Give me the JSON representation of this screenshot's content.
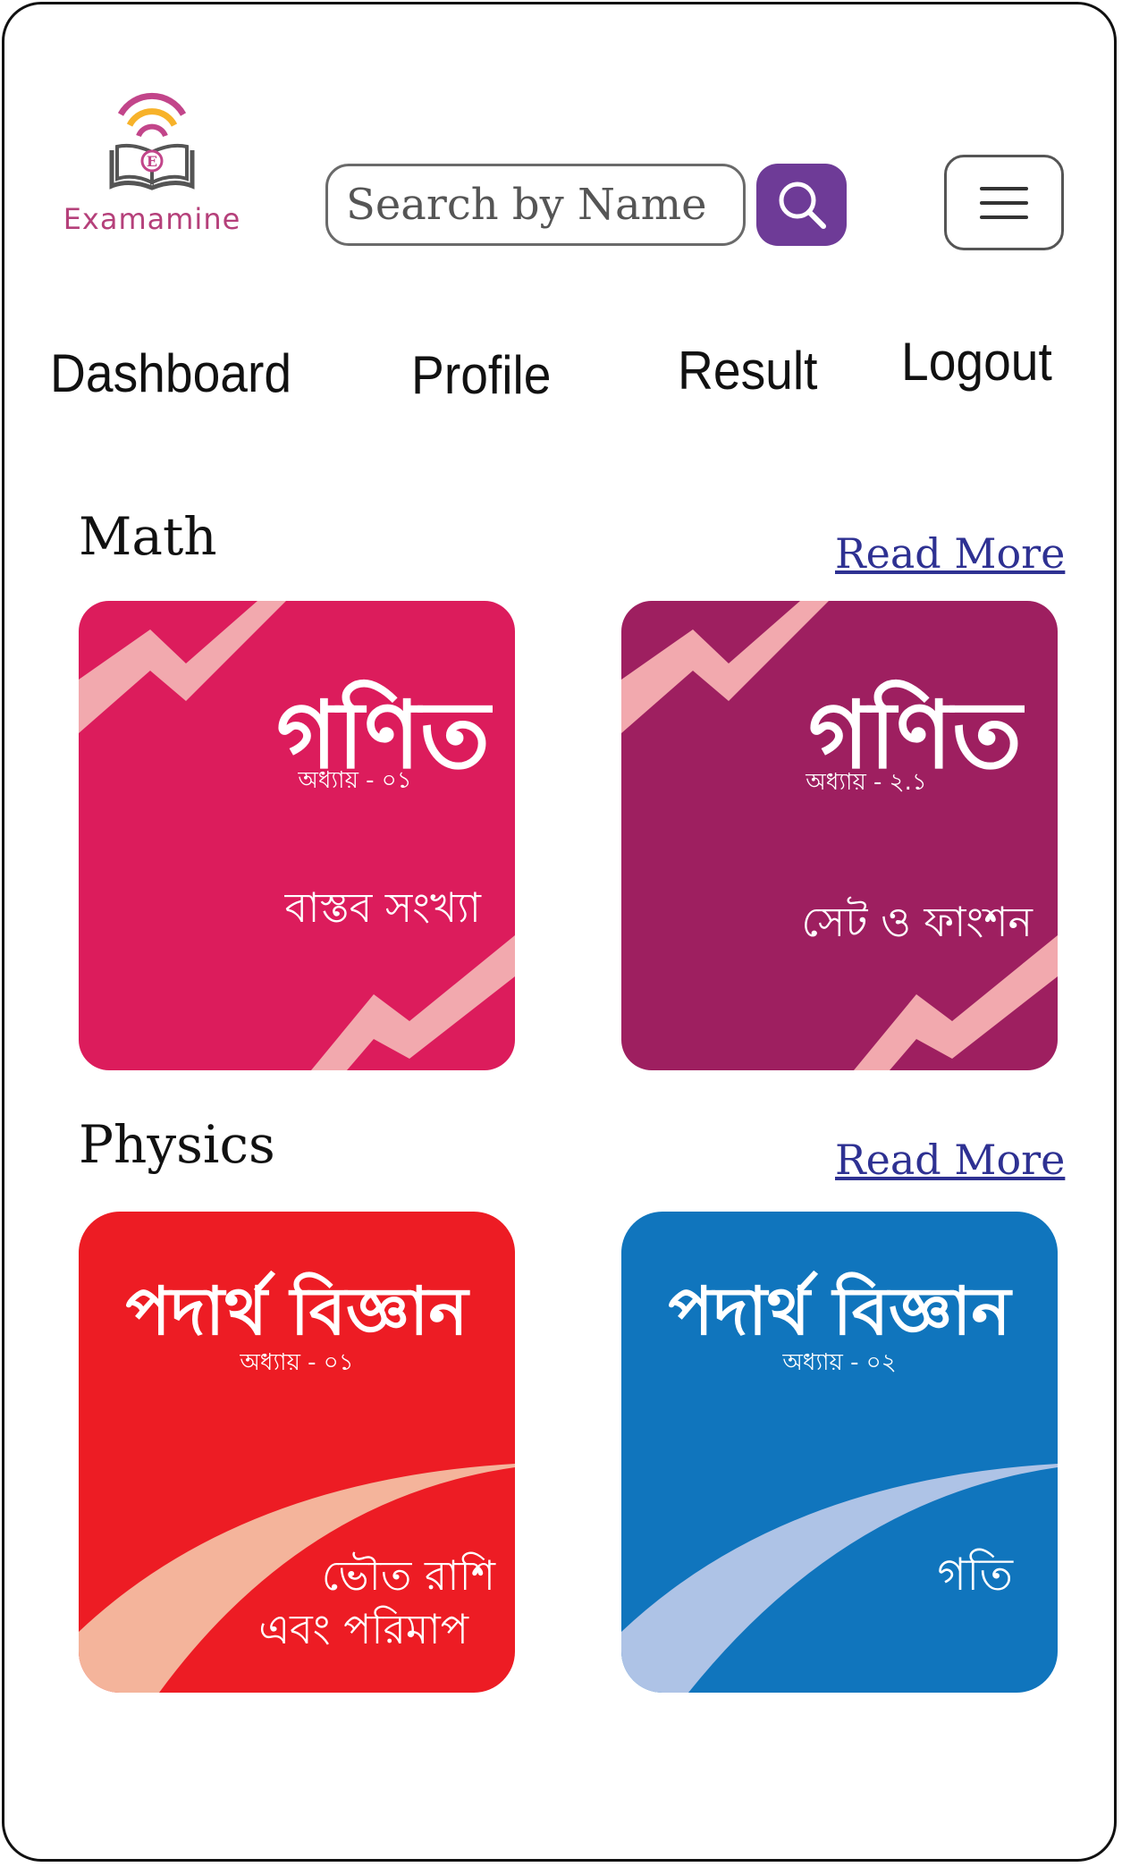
{
  "app": {
    "name": "Examamine"
  },
  "search": {
    "placeholder": "Search by Name"
  },
  "nav": {
    "dashboard": "Dashboard",
    "profile": "Profile",
    "result": "Result",
    "logout": "Logout"
  },
  "sections": [
    {
      "title": "Math",
      "read_more": "Read More",
      "cards": [
        {
          "title": "গণিত",
          "chapter": "অধ্যায় - ০১",
          "topic": "বাস্তব সংখ্যা",
          "color": "#dc1c5c",
          "accent": "#f2a9ae"
        },
        {
          "title": "গণিত",
          "chapter": "অধ্যায় - ২.১",
          "topic": "সেট ও ফাংশন",
          "color": "#9e1f60",
          "accent": "#f2a9ae"
        }
      ]
    },
    {
      "title": "Physics",
      "read_more": "Read More",
      "cards": [
        {
          "title": "পদার্থ বিজ্ঞান",
          "chapter": "অধ্যায় - ০১",
          "topic_line1": "ভৌত রাশি",
          "topic_line2": "এবং পরিমাপ",
          "color": "#ed1c24",
          "accent": "#f4b49b"
        },
        {
          "title": "পদার্থ বিজ্ঞান",
          "chapter": "অধ্যায় - ০২",
          "topic": "গতি",
          "color": "#1075bd",
          "accent": "#aec3e6"
        }
      ]
    }
  ]
}
